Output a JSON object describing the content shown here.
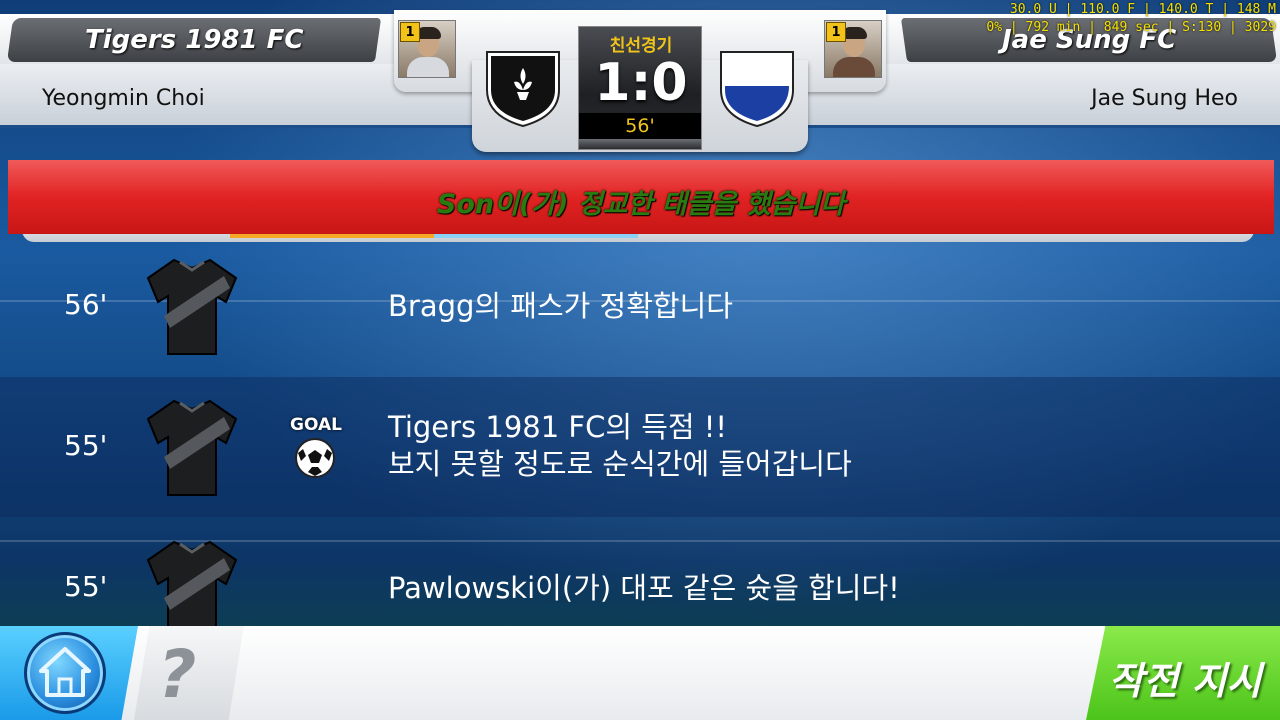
{
  "debug": {
    "line1": "30.0 U | 110.0 F | 140.0 T | 148 M",
    "line2": "0% | 792 min | 849 sec |  S:130 | 3029"
  },
  "header": {
    "home_team": "Tigers 1981 FC",
    "away_team": "Jae Sung FC",
    "home_manager": "Yeongmin Choi",
    "away_manager": "Jae Sung Heo",
    "home_level": "1",
    "away_level": "1",
    "match_type": "친선경기",
    "score": "1:0",
    "minute": "56'"
  },
  "banner": {
    "text": "Son이(가) 정교한 태클을 했습니다"
  },
  "events": [
    {
      "minute": "56'",
      "line1": "Bragg의 패스가 정확합니다",
      "line2": "",
      "goal": false
    },
    {
      "minute": "55'",
      "line1": "Tigers 1981 FC의 득점 !!",
      "line2": "보지 못할 정도로 순식간에 들어갑니다",
      "goal": true,
      "goal_label": "GOAL"
    },
    {
      "minute": "55'",
      "line1": "Pawlowski이(가) 대포 같은 슛을 합니다!",
      "line2": "",
      "goal": false
    }
  ],
  "footer": {
    "help_label": "?",
    "tactics_label": "작전 지시"
  },
  "colors": {
    "banner_red": "#e12323",
    "banner_text": "#2a7a12",
    "score_gold": "#f0c419",
    "tactics_green": "#4cc41a",
    "home_blue": "#1a9ae8"
  },
  "icons": {
    "home": "home-icon",
    "help": "question-icon",
    "home_crest": "fleur-de-lis-crest-icon",
    "away_crest": "blue-white-crest-icon",
    "jersey": "jersey-icon",
    "ball": "soccer-ball-icon"
  }
}
